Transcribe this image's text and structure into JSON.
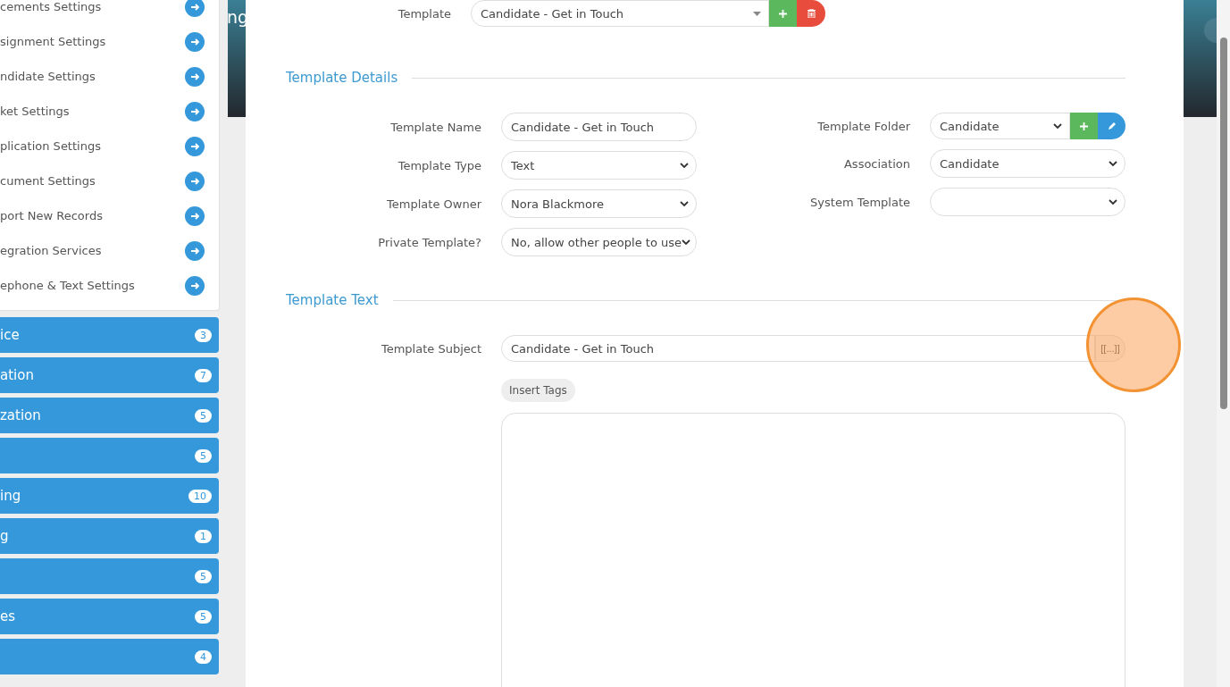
{
  "sidebar": {
    "settings_items": [
      {
        "label": "cements Settings"
      },
      {
        "label": "signment Settings"
      },
      {
        "label": "ndidate Settings"
      },
      {
        "label": "ket Settings"
      },
      {
        "label": "plication Settings"
      },
      {
        "label": "cument Settings"
      },
      {
        "label": "port New Records"
      },
      {
        "label": "egration Services"
      },
      {
        "label": "ephone & Text Settings"
      }
    ],
    "groups": [
      {
        "label": "ice",
        "count": "3"
      },
      {
        "label": "ation",
        "count": "7"
      },
      {
        "label": "zation",
        "count": "5"
      },
      {
        "count": "5"
      },
      {
        "label": "ing",
        "count": "10"
      },
      {
        "label": "g",
        "count": "1"
      },
      {
        "count": "5"
      },
      {
        "label": "es",
        "count": "5"
      },
      {
        "count": "4"
      }
    ]
  },
  "banner": {
    "title": "ng"
  },
  "template_picker": {
    "label": "Template",
    "value": "Candidate - Get in Touch"
  },
  "template_details": {
    "title": "Template Details",
    "left_fields": [
      {
        "label": "Template Name",
        "value": "Candidate - Get in Touch",
        "kind": "input"
      },
      {
        "label": "Template Type",
        "value": "Text",
        "kind": "select"
      },
      {
        "label": "Template Owner",
        "value": "Nora Blackmore",
        "kind": "select"
      },
      {
        "label": "Private Template?",
        "value": "No, allow other people to use",
        "kind": "select"
      }
    ],
    "right_fields": [
      {
        "label": "Template Folder",
        "value": "Candidate",
        "kind": "select-actions"
      },
      {
        "label": "Association",
        "value": "Candidate",
        "kind": "select"
      },
      {
        "label": "System Template",
        "kind": "select"
      }
    ]
  },
  "template_text": {
    "title": "Template Text",
    "subject": {
      "label": "Template Subject",
      "value": "Candidate - Get in Touch",
      "tag_button": "[[...]]"
    },
    "insert_tags": "Insert Tags"
  }
}
